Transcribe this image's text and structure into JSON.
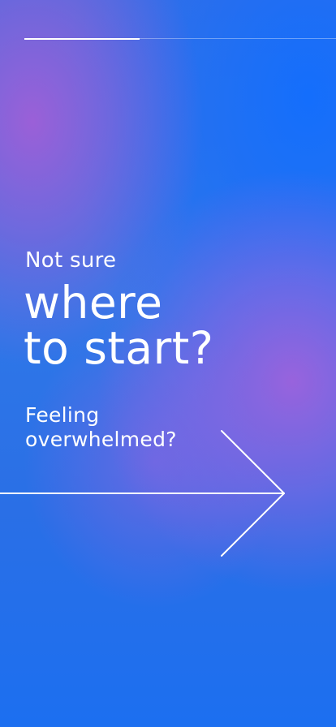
{
  "progress": {
    "fraction": 0.37
  },
  "content": {
    "eyebrow": "Not sure",
    "headline_line1": "where",
    "headline_line2": "to start?",
    "subline_line1": "Feeling",
    "subline_line2": "overwhelmed?"
  },
  "icons": {
    "next": "arrow-right-icon"
  },
  "colors": {
    "text": "#ffffff",
    "gradient_blue": "#1c6ff0",
    "gradient_purple": "#9e62dc"
  }
}
